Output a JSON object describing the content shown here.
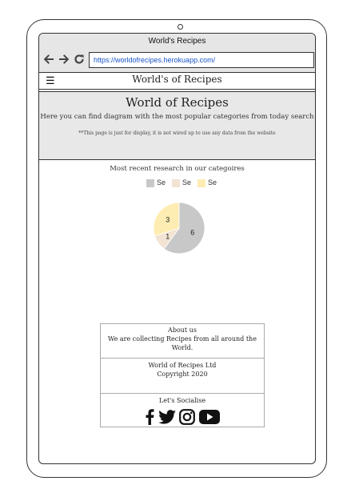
{
  "browser": {
    "title": "World's Recipes",
    "url": "https://worldofrecipes.herokuapp.com/"
  },
  "navbar": {
    "brand": "World's of Recipes"
  },
  "hero": {
    "title": "World of Recipes",
    "lead": "Here you can find diagram with the most popular categories from today search",
    "note": "**This page is just for display, it is not wired up to use any data from the website"
  },
  "chart": {
    "heading": "Most recent research in our categoires"
  },
  "chart_data": {
    "type": "pie",
    "categories": [
      "Se",
      "Se",
      "Se"
    ],
    "values": [
      6,
      1,
      3
    ],
    "colors": [
      "#c8c8c8",
      "#f2e3d2",
      "#fdedb2"
    ],
    "legend_position": "top"
  },
  "footer": {
    "about_title": "About us",
    "about_text": "We are collecting Recipes from all around the World.",
    "company_name": "World of Recipes Ltd",
    "copyright": "Copyright 2020",
    "social_title": "Let's Socialise",
    "social_icons": [
      "facebook-icon",
      "twitter-icon",
      "instagram-icon",
      "youtube-icon"
    ]
  }
}
